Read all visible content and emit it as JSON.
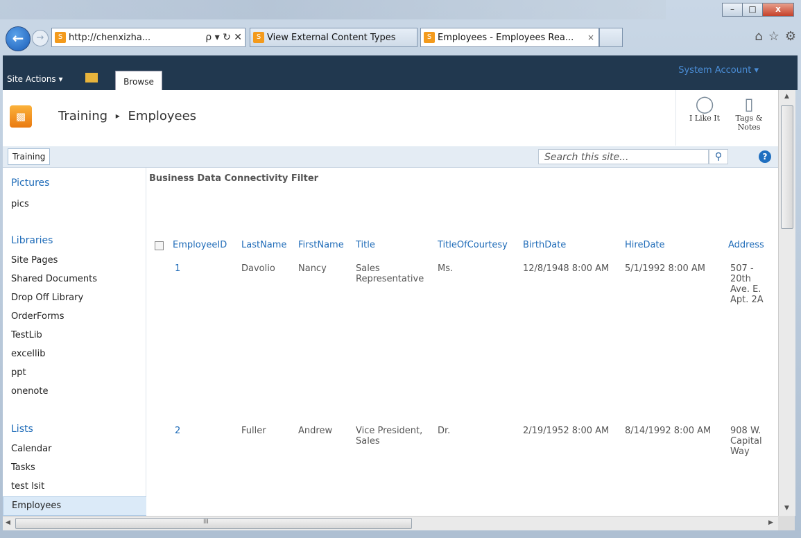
{
  "browser": {
    "back_icon": "back-arrow-icon",
    "forward_icon": "forward-arrow-icon",
    "address": "http://chenxizha...",
    "address_controls": "ρ ▾ ↻ ✕",
    "tabs": [
      {
        "label": "View External Content Types"
      },
      {
        "label": "Employees - Employees Rea...",
        "close": "×"
      }
    ],
    "right_icons": [
      "home-icon",
      "star-icon",
      "gear-icon"
    ],
    "window_buttons": {
      "minimize": "–",
      "maximize": "□",
      "close": "x"
    }
  },
  "ribbon": {
    "site_actions": "Site Actions ▾",
    "browse_tab": "Browse",
    "user": "System Account ▾"
  },
  "titlebar": {
    "site": "Training",
    "separator": "▸",
    "page": "Employees",
    "like_label": "I Like It",
    "tags_label_1": "Tags &",
    "tags_label_2": "Notes"
  },
  "toplinks": {
    "home": "Training",
    "search_placeholder": "Search this site...",
    "help": "?"
  },
  "leftnav": {
    "pictures_header": "Pictures",
    "pictures_items": [
      "pics"
    ],
    "libraries_header": "Libraries",
    "libraries_items": [
      "Site Pages",
      "Shared Documents",
      "Drop Off Library",
      "OrderForms",
      "TestLib",
      "excellib",
      "ppt",
      "onenote"
    ],
    "lists_header": "Lists",
    "lists_items": [
      "Calendar",
      "Tasks",
      "test lsit",
      "Employees"
    ]
  },
  "webpart": {
    "title": "Business Data Connectivity Filter",
    "columns": [
      "EmployeeID",
      "LastName",
      "FirstName",
      "Title",
      "TitleOfCourtesy",
      "BirthDate",
      "HireDate",
      "Address"
    ],
    "rows": [
      {
        "EmployeeID": "1",
        "LastName": "Davolio",
        "FirstName": "Nancy",
        "Title_1": "Sales",
        "Title_2": "Representative",
        "TitleOfCourtesy": "Ms.",
        "BirthDate": "12/8/1948 8:00 AM",
        "HireDate": "5/1/1992 8:00 AM",
        "Address_1": "507 -",
        "Address_2": "20th",
        "Address_3": "Ave. E.",
        "Address_4": "Apt. 2A"
      },
      {
        "EmployeeID": "2",
        "LastName": "Fuller",
        "FirstName": "Andrew",
        "Title_1": "Vice President,",
        "Title_2": "Sales",
        "TitleOfCourtesy": "Dr.",
        "BirthDate": "2/19/1952 8:00 AM",
        "HireDate": "8/14/1992 8:00 AM",
        "Address_1": "908 W.",
        "Address_2": "Capital",
        "Address_3": "Way"
      }
    ]
  },
  "scrollbar": {
    "h_mid": "III"
  }
}
